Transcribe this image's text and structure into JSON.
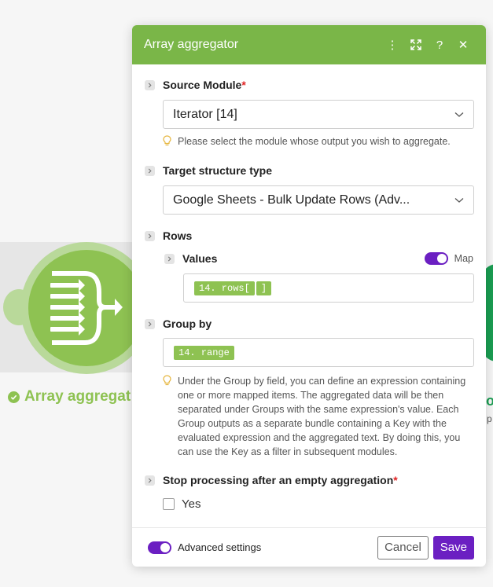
{
  "canvas": {
    "node_label": "Array aggregat",
    "right_node_letter": "o",
    "right_node_sub": "p",
    "accent_green": "#8ec252",
    "accent_dark_green": "#1a9d52"
  },
  "dialog": {
    "title": "Array aggregator",
    "header_color": "#7ab648",
    "icons": [
      "more-icon",
      "expand-icon",
      "help-icon",
      "close-icon"
    ],
    "help_glyph": "?",
    "close_glyph": "✕",
    "more_glyph": "⋮"
  },
  "source_module": {
    "label": "Source Module",
    "required_mark": "*",
    "value": "Iterator [14]",
    "hint": "Please select the module whose output you wish to aggregate."
  },
  "target_structure": {
    "label": "Target structure type",
    "value": "Google Sheets - Bulk Update Rows (Adv..."
  },
  "rows": {
    "label": "Rows",
    "values": {
      "label": "Values",
      "map_label": "Map",
      "map_enabled": true,
      "pill_1": "14. rows[",
      "pill_2": "]"
    }
  },
  "group_by": {
    "label": "Group by",
    "pill": "14. range",
    "hint": "Under the Group by field, you can define an expression containing one or more mapped items. The aggregated data will be then separated under Groups with the same expression's value. Each Group outputs as a separate bundle containing a Key with the evaluated expression and the aggregated text. By doing this, you can use the Key as a filter in subsequent modules."
  },
  "stop_processing": {
    "label": "Stop processing after an empty aggregation",
    "required_mark": "*",
    "option_label": "Yes",
    "checked": false
  },
  "footer": {
    "advanced_label": "Advanced settings",
    "advanced_enabled": true,
    "cancel_label": "Cancel",
    "save_label": "Save",
    "primary_color": "#6b1fc2"
  }
}
